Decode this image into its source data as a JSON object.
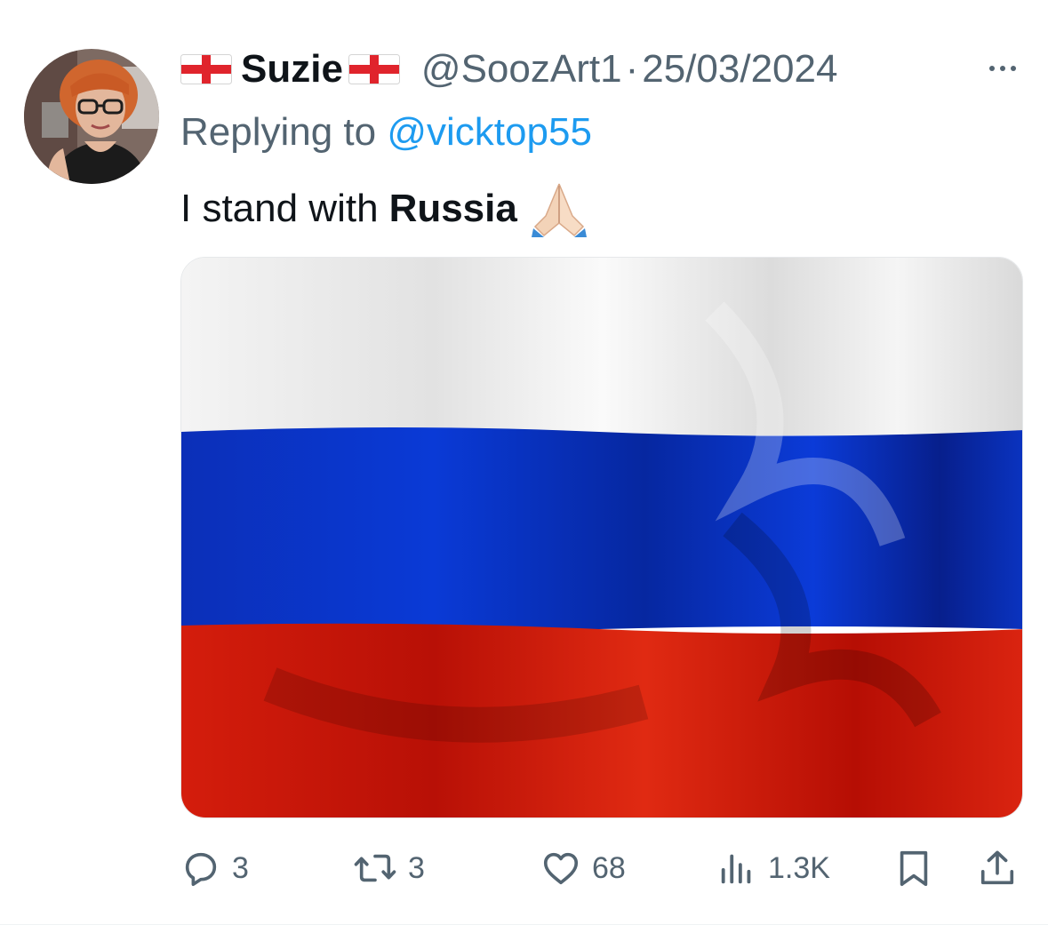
{
  "tweet": {
    "author": {
      "display_name": "Suzie",
      "handle": "@SoozArt1",
      "name_emoji": "england-flag-icon"
    },
    "separator": "·",
    "date": "25/03/2024",
    "reply_prefix": "Replying to ",
    "reply_to": "@vicktop55",
    "text_plain": "I stand with",
    "text_bold": "Russia",
    "text_emoji": "folded-hands-icon",
    "media": {
      "description_icon": "russia-flag-image",
      "colors": {
        "white": "#f3f3f3",
        "blue": "#0a36c8",
        "red": "#d01a0a"
      }
    },
    "stats": {
      "replies": "3",
      "retweets": "3",
      "likes": "68",
      "views": "1.3K"
    }
  },
  "colors": {
    "text": "#0f1419",
    "secondary": "#536471",
    "link": "#1d9bf0"
  }
}
